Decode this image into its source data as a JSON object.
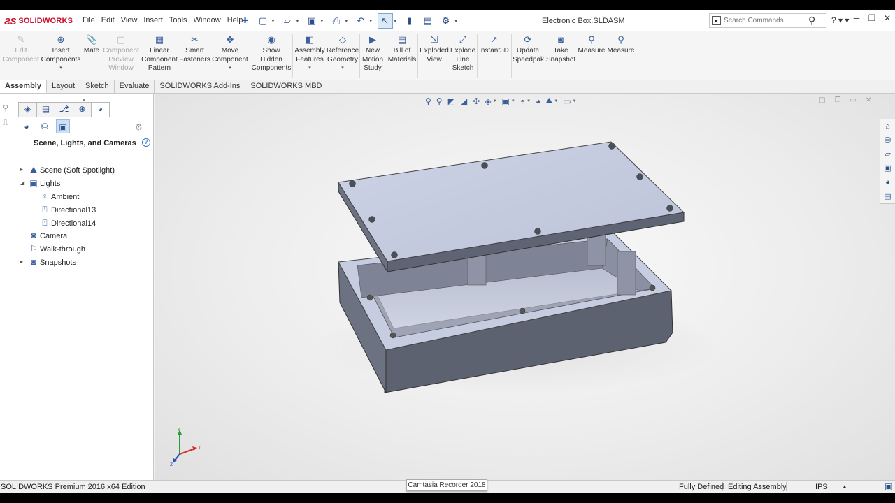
{
  "app": {
    "logo_text": "SOLIDWORKS",
    "document_title": "Electronic Box.SLDASM",
    "menus": [
      "File",
      "Edit",
      "View",
      "Insert",
      "Tools",
      "Window",
      "Help"
    ],
    "search_placeholder": "Search Commands"
  },
  "commands": [
    {
      "label": "Edit\nComponent",
      "icon": "edit-component-icon",
      "enabled": false
    },
    {
      "label": "Insert\nComponents",
      "icon": "insert-components-icon",
      "enabled": true,
      "dropdown": true
    },
    {
      "label": "Mate",
      "icon": "mate-icon",
      "enabled": true
    },
    {
      "label": "Component\nPreview\nWindow",
      "icon": "preview-window-icon",
      "enabled": false
    },
    {
      "label": "Linear\nComponent\nPattern",
      "icon": "linear-pattern-icon",
      "enabled": true
    },
    {
      "label": "Smart\nFasteners",
      "icon": "smart-fasteners-icon",
      "enabled": true
    },
    {
      "label": "Move\nComponent",
      "icon": "move-component-icon",
      "enabled": true,
      "dropdown": true
    },
    {
      "label": "Show\nHidden\nComponents",
      "icon": "show-hidden-icon",
      "enabled": true
    },
    {
      "label": "Assembly\nFeatures",
      "icon": "assembly-features-icon",
      "enabled": true,
      "dropdown": true
    },
    {
      "label": "Reference\nGeometry",
      "icon": "reference-geometry-icon",
      "enabled": true,
      "dropdown": true
    },
    {
      "label": "New\nMotion\nStudy",
      "icon": "motion-study-icon",
      "enabled": true
    },
    {
      "label": "Bill of\nMaterials",
      "icon": "bill-of-materials-icon",
      "enabled": true
    },
    {
      "label": "Exploded\nView",
      "icon": "exploded-view-icon",
      "enabled": true
    },
    {
      "label": "Explode\nLine\nSketch",
      "icon": "explode-line-icon",
      "enabled": true
    },
    {
      "label": "Instant3D",
      "icon": "instant3d-icon",
      "enabled": true
    },
    {
      "label": "Update\nSpeedpak",
      "icon": "speedpak-icon",
      "enabled": true
    },
    {
      "label": "Take\nSnapshot",
      "icon": "camera-icon",
      "enabled": true
    },
    {
      "label": "Measure",
      "icon": "measure-icon",
      "enabled": true
    },
    {
      "label": "Measure",
      "icon": "measure-icon",
      "enabled": true
    }
  ],
  "tabs": [
    {
      "label": "Assembly",
      "active": true
    },
    {
      "label": "Layout",
      "active": false
    },
    {
      "label": "Sketch",
      "active": false
    },
    {
      "label": "Evaluate",
      "active": false
    },
    {
      "label": "SOLIDWORKS Add-Ins",
      "active": false
    },
    {
      "label": "SOLIDWORKS MBD",
      "active": false
    }
  ],
  "panel": {
    "title": "Scene, Lights, and Cameras",
    "tree": [
      {
        "label": "Scene (Soft Spotlight)",
        "level": 0,
        "toggle": "collapsed",
        "icon": "scene-icon"
      },
      {
        "label": "Lights",
        "level": 0,
        "toggle": "expanded",
        "icon": "lights-folder-icon"
      },
      {
        "label": "Ambient",
        "level": 1,
        "toggle": "none",
        "icon": "ambient-light-icon"
      },
      {
        "label": "Directional13",
        "level": 1,
        "toggle": "none",
        "icon": "directional-light-icon"
      },
      {
        "label": "Directional14",
        "level": 1,
        "toggle": "none",
        "icon": "directional-light-icon"
      },
      {
        "label": "Camera",
        "level": 0,
        "toggle": "none",
        "icon": "camera-folder-icon"
      },
      {
        "label": "Walk-through",
        "level": 0,
        "toggle": "none",
        "icon": "walk-through-icon"
      },
      {
        "label": "Snapshots",
        "level": 0,
        "toggle": "collapsed",
        "icon": "snapshots-icon"
      }
    ]
  },
  "status": {
    "edition": "SOLIDWORKS Premium 2016 x64 Edition",
    "recorder": "Camtasia Recorder 2018",
    "state": "Fully Defined",
    "mode": "Editing Assembly",
    "units": "IPS"
  },
  "colors": {
    "brand": "#c8102e",
    "model_top": "#c6cce0",
    "model_side": "#6d7282",
    "model_dark": "#4b4f5c",
    "panel_bg": "#ffffff"
  }
}
